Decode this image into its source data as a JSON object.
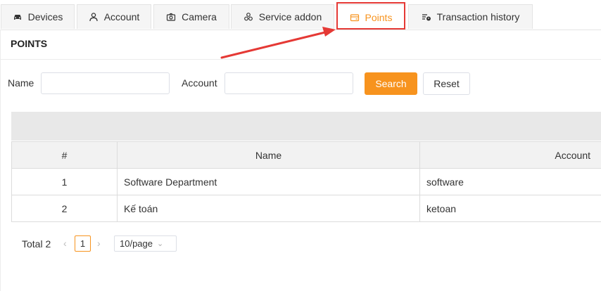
{
  "tabs": [
    {
      "label": "Devices",
      "icon": "car-icon"
    },
    {
      "label": "Account",
      "icon": "user-icon"
    },
    {
      "label": "Camera",
      "icon": "camera-icon"
    },
    {
      "label": "Service addon",
      "icon": "service-addon-icon"
    },
    {
      "label": "Points",
      "icon": "wallet-icon"
    },
    {
      "label": "Transaction history",
      "icon": "transaction-icon"
    }
  ],
  "active_tab": "Points",
  "page_title": "POINTS",
  "search": {
    "name_label": "Name",
    "name_value": "",
    "account_label": "Account",
    "account_value": "",
    "search_button": "Search",
    "reset_button": "Reset"
  },
  "table": {
    "columns": [
      "#",
      "Name",
      "Account"
    ],
    "rows": [
      {
        "num": "1",
        "name": "Software Department",
        "account": "software"
      },
      {
        "num": "2",
        "name": "Kế toán",
        "account": "ketoan"
      }
    ]
  },
  "pagination": {
    "total": "Total 2",
    "current_page": "1",
    "page_size": "10/page"
  },
  "colors": {
    "accent": "#f7931e",
    "highlight": "#e53935"
  }
}
